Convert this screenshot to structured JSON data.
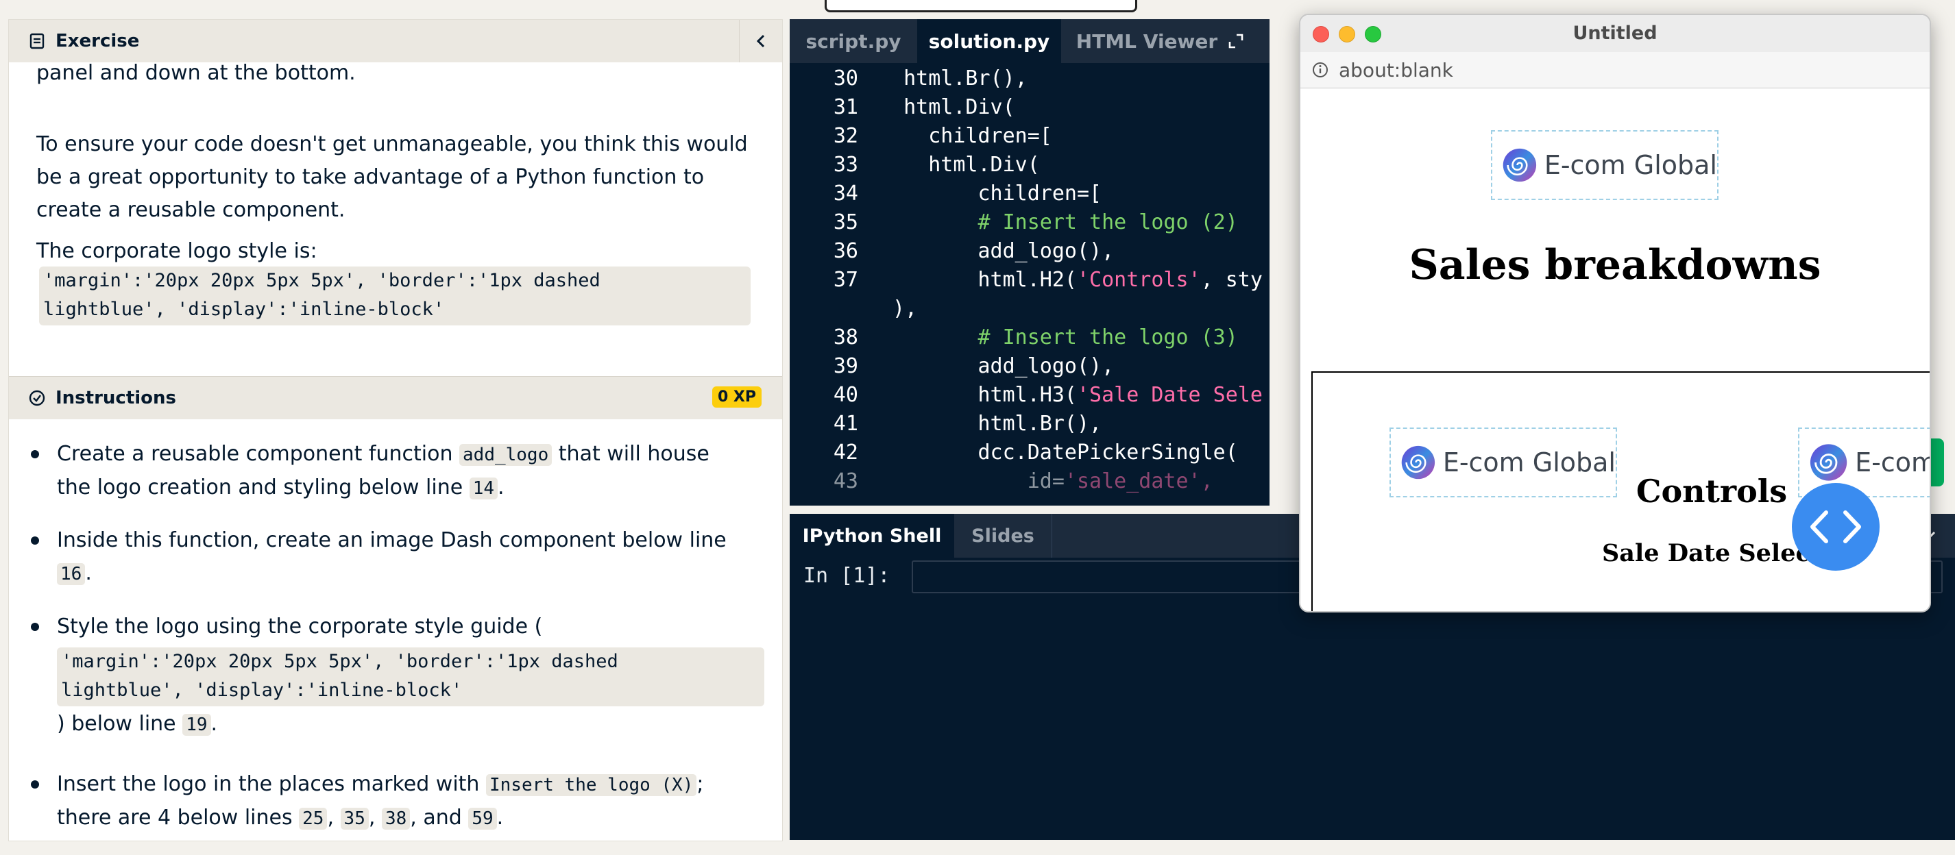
{
  "exercise": {
    "header": "Exercise",
    "para1": "panel and down at the bottom.",
    "para2_lines": [
      "To ensure your code doesn't get unmanageable, you think this would",
      "be a great opportunity to take advantage of a Python function to",
      "create a reusable component."
    ],
    "para3": "The corporate logo style is:",
    "style_code_lines": [
      "'margin':'20px 20px 5px 5px', 'border':'1px dashed",
      "lightblue', 'display':'inline-block'"
    ]
  },
  "instructions": {
    "header": "Instructions",
    "xp": "0 XP",
    "b1": {
      "a": "Create a reusable component function ",
      "code": "add_logo",
      "b": " that will house",
      "c": "the logo creation and styling below line ",
      "line": "14",
      "d": "."
    },
    "b2": {
      "a": "Inside this function, create an image Dash component below line",
      "line": "16",
      "d": "."
    },
    "b3": {
      "a": "Style the logo using the corporate style guide (",
      "code1": "'margin':'20px 20px 5px 5px', 'border':'1px dashed",
      "code2": "lightblue', 'display':'inline-block'",
      "c": ") below line ",
      "line": "19",
      "d": "."
    },
    "b4": {
      "a": "Insert the logo in the places marked with ",
      "code": "Insert the logo (X)",
      "b": ";",
      "c": "there are 4 below lines ",
      "l1": "25",
      "s1": ", ",
      "l2": "35",
      "s2": ", ",
      "l3": "38",
      "s3": ", and ",
      "l4": "59",
      "d": "."
    }
  },
  "editor": {
    "tabs": [
      "script.py",
      "solution.py",
      "HTML Viewer"
    ],
    "active_tab": "solution.py",
    "lines": [
      {
        "n": "30",
        "code": "  html.Br(),"
      },
      {
        "n": "31",
        "code": "  html.Div("
      },
      {
        "n": "32",
        "code": "    children=["
      },
      {
        "n": "33",
        "code": "    html.Div("
      },
      {
        "n": "34",
        "code": "        children=["
      },
      {
        "n": "35",
        "comment": "        # Insert the logo (2)"
      },
      {
        "n": "36",
        "code": "        add_logo(),"
      },
      {
        "n": "37",
        "code": "        html.H2(",
        "str": "'Controls'",
        "tail": ", sty"
      },
      {
        "n": "",
        "code": "),"
      },
      {
        "n": "38",
        "comment": "        # Insert the logo (3)"
      },
      {
        "n": "39",
        "code": "        add_logo(),"
      },
      {
        "n": "40",
        "code": "        html.H3(",
        "str": "'Sale Date Sele"
      },
      {
        "n": "41",
        "code": "        html.Br(),"
      },
      {
        "n": "42",
        "code": "        dcc.DatePickerSingle("
      },
      {
        "n": "43",
        "code": "            id=",
        "str": "'sale_date',"
      }
    ]
  },
  "shell": {
    "tabs": [
      "IPython Shell",
      "Slides"
    ],
    "prompt": "In [1]:"
  },
  "browser": {
    "title": "Untitled",
    "url": "about:blank",
    "logo_text": "E-com Global",
    "heading": "Sales breakdowns",
    "controls": "Controls",
    "sale_date": "Sale Date Select",
    "logo_text_cut": "E-com"
  },
  "colors": {
    "accent_yellow": "#fcce0d",
    "editor_bg": "#05192d",
    "fab_blue": "#3a8cf0"
  }
}
